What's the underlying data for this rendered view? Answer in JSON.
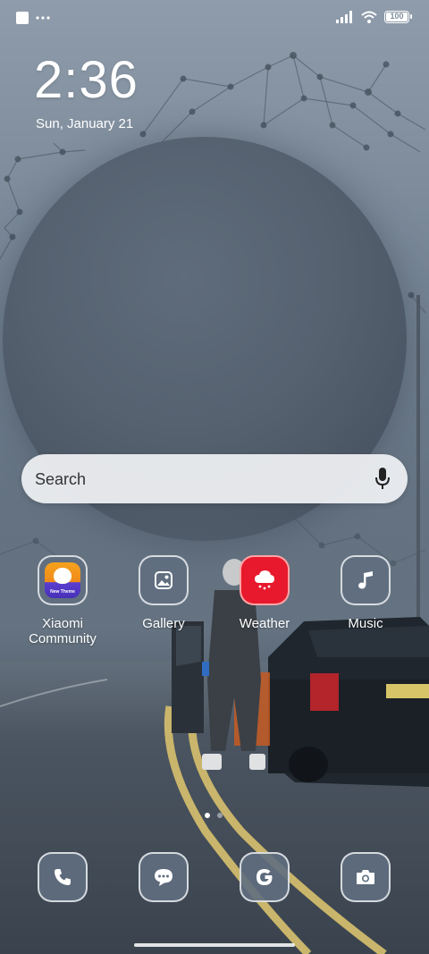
{
  "status_bar": {
    "notification_icon": "notification-square-icon",
    "overflow_icon": "more-dots-icon",
    "signal_icon": "signal-bars-icon",
    "wifi_icon": "wifi-icon",
    "battery_level": "100"
  },
  "lock_clock": {
    "time": "2:36",
    "date": "Sun, January 21"
  },
  "search": {
    "placeholder": "Search",
    "mic_icon": "microphone-icon"
  },
  "apps": [
    {
      "label": "Xiaomi\nCommunity",
      "icon": "xiaomi-community-icon",
      "badge_text": "New Theme"
    },
    {
      "label": "Gallery",
      "icon": "gallery-icon"
    },
    {
      "label": "Weather",
      "icon": "weather-icon"
    },
    {
      "label": "Music",
      "icon": "music-icon"
    }
  ],
  "pages": {
    "count": 2,
    "current": 1
  },
  "dock": [
    {
      "name": "Phone",
      "icon": "phone-icon"
    },
    {
      "name": "Messages",
      "icon": "messages-icon"
    },
    {
      "name": "Google",
      "icon": "google-icon"
    },
    {
      "name": "Camera",
      "icon": "camera-icon"
    }
  ],
  "colors": {
    "weather_accent": "#e8192c",
    "icon_background": "#5f6e80",
    "search_background": "#eceef1"
  }
}
